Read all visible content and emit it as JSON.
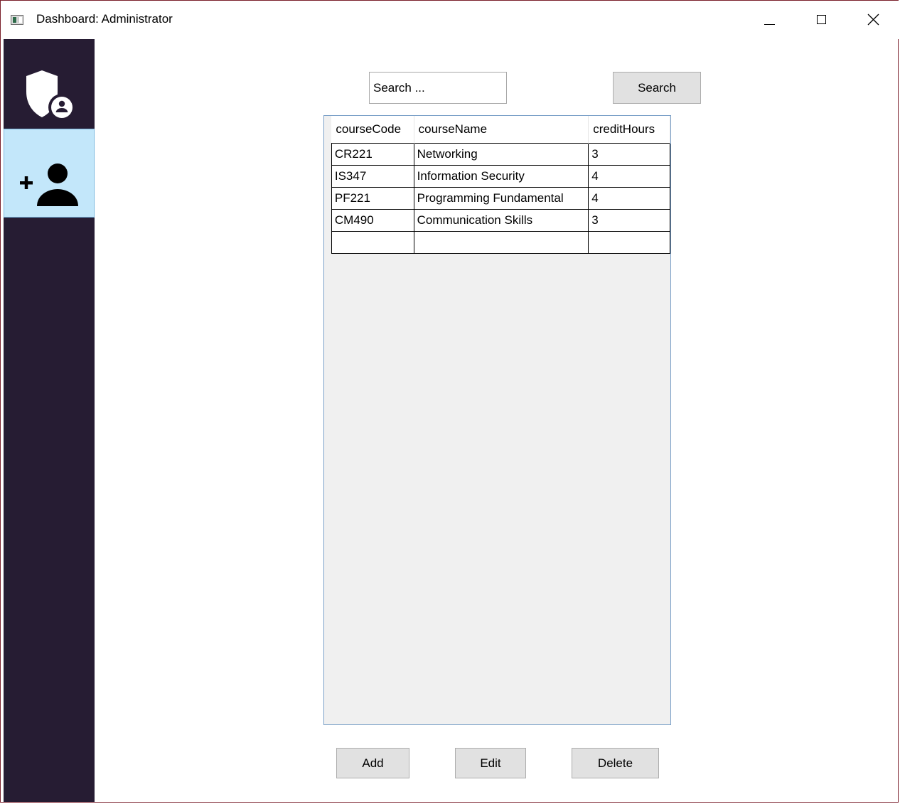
{
  "window": {
    "title": "Dashboard: Administrator"
  },
  "colors": {
    "sidebar_bg": "#261c33",
    "sidebar_selected_bg": "#c3e7fa",
    "button_bg": "#e1e1e1",
    "grid_border": "#7aa0c8"
  },
  "sidebar": {
    "items": [
      {
        "icon": "admin-shield-icon",
        "selected": false
      },
      {
        "icon": "add-user-icon",
        "selected": true
      }
    ]
  },
  "search": {
    "value": "Search ...",
    "button_label": "Search"
  },
  "grid": {
    "columns": [
      "courseCode",
      "courseName",
      "creditHours"
    ],
    "rows": [
      [
        "CR221",
        "Networking",
        "3"
      ],
      [
        "IS347",
        "Information Security",
        "4"
      ],
      [
        "PF221",
        "Programming Fundamental",
        "4"
      ],
      [
        "CM490",
        "Communication Skills",
        "3"
      ],
      [
        "",
        "",
        ""
      ]
    ]
  },
  "actions": {
    "add_label": "Add",
    "edit_label": "Edit",
    "delete_label": "Delete"
  }
}
